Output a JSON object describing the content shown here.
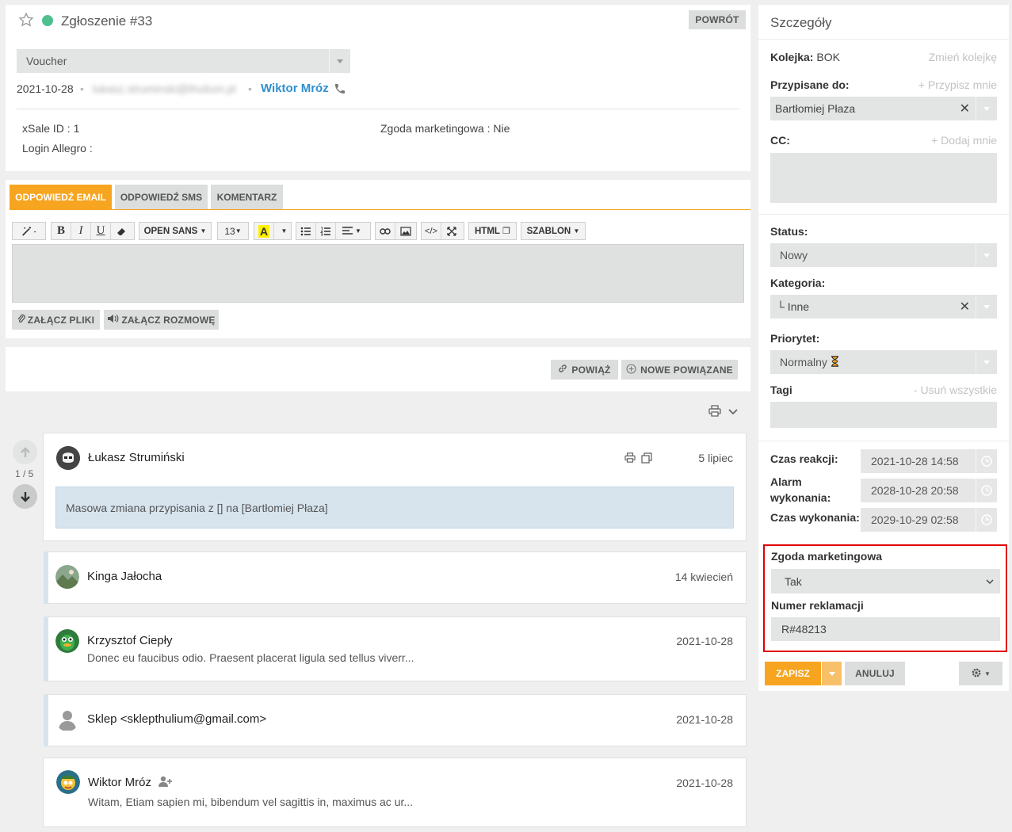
{
  "ticket": {
    "title": "Zgłoszenie #33",
    "back_label": "POWRÓT",
    "type_select": "Voucher",
    "date": "2021-10-28",
    "email_blurred": "lukasz.struminski@thulium.pl",
    "contact_name": "Wiktor Mróz",
    "fields": {
      "xsale": "xSale ID : 1",
      "login": "Login Allegro :",
      "marketing": "Zgoda marketingowa : Nie"
    }
  },
  "reply": {
    "tabs": [
      "ODPOWIEDŹ EMAIL",
      "ODPOWIEDŹ SMS",
      "KOMENTARZ"
    ],
    "toolbar": {
      "font_family": "OPEN SANS",
      "font_size": "13",
      "html_label": "HTML",
      "template_label": "SZABLON"
    },
    "attach_files": "ZAŁĄCZ PLIKI",
    "attach_call": "ZAŁĄCZ ROZMOWĘ"
  },
  "links": {
    "link_label": "POWIĄŻ",
    "new_related": "NOWE POWIĄZANE"
  },
  "thread": {
    "counter": "1 / 5",
    "messages": [
      {
        "author": "Łukasz Strumiński",
        "date": "5 lipiec",
        "body": "Masowa zmiana przypisania z [] na [Bartłomiej Płaza]"
      },
      {
        "author": "Kinga Jałocha",
        "date": "14 kwiecień",
        "body": ""
      },
      {
        "author": "Krzysztof Ciepły",
        "date": "2021-10-28",
        "body": "Donec eu faucibus odio. Praesent placerat ligula sed tellus viverr..."
      },
      {
        "author": "Sklep <sklepthulium@gmail.com>",
        "date": "2021-10-28",
        "body": ""
      },
      {
        "author": "Wiktor Mróz",
        "date": "2021-10-28",
        "body": "Witam, Etiam sapien mi, bibendum vel sagittis in, maximus ac ur..."
      }
    ]
  },
  "details": {
    "heading": "Szczegóły",
    "queue_label": "Kolejka:",
    "queue_value": "BOK",
    "change_queue": "Zmień kolejkę",
    "assigned_label": "Przypisane do:",
    "assign_me": "+ Przypisz mnie",
    "assigned_value": "Bartłomiej Płaza",
    "cc_label": "CC:",
    "add_me": "+ Dodaj mnie",
    "status_label": "Status:",
    "status_value": "Nowy",
    "category_label": "Kategoria:",
    "category_value": "└ Inne",
    "priority_label": "Priorytet:",
    "priority_value": "Normalny",
    "tags_label": "Tagi",
    "remove_all": "- Usuń wszystkie",
    "reaction_label": "Czas reakcji:",
    "reaction_value": "2021-10-28 14:58",
    "alarm_label": "Alarm wykonania:",
    "alarm_value": "2028-10-28 20:58",
    "exec_label": "Czas wykonania:",
    "exec_value": "2029-10-29 02:58",
    "custom": {
      "marketing_label": "Zgoda marketingowa",
      "marketing_value": "Tak",
      "complaint_label": "Numer reklamacji",
      "complaint_value": "R#48213"
    },
    "save_label": "ZAPISZ",
    "cancel_label": "ANULUJ"
  },
  "colors": {
    "accent": "#f7a520",
    "link": "#2f8fd0",
    "status_dot": "#4fbf8f",
    "highlight_border": "#e00000"
  }
}
